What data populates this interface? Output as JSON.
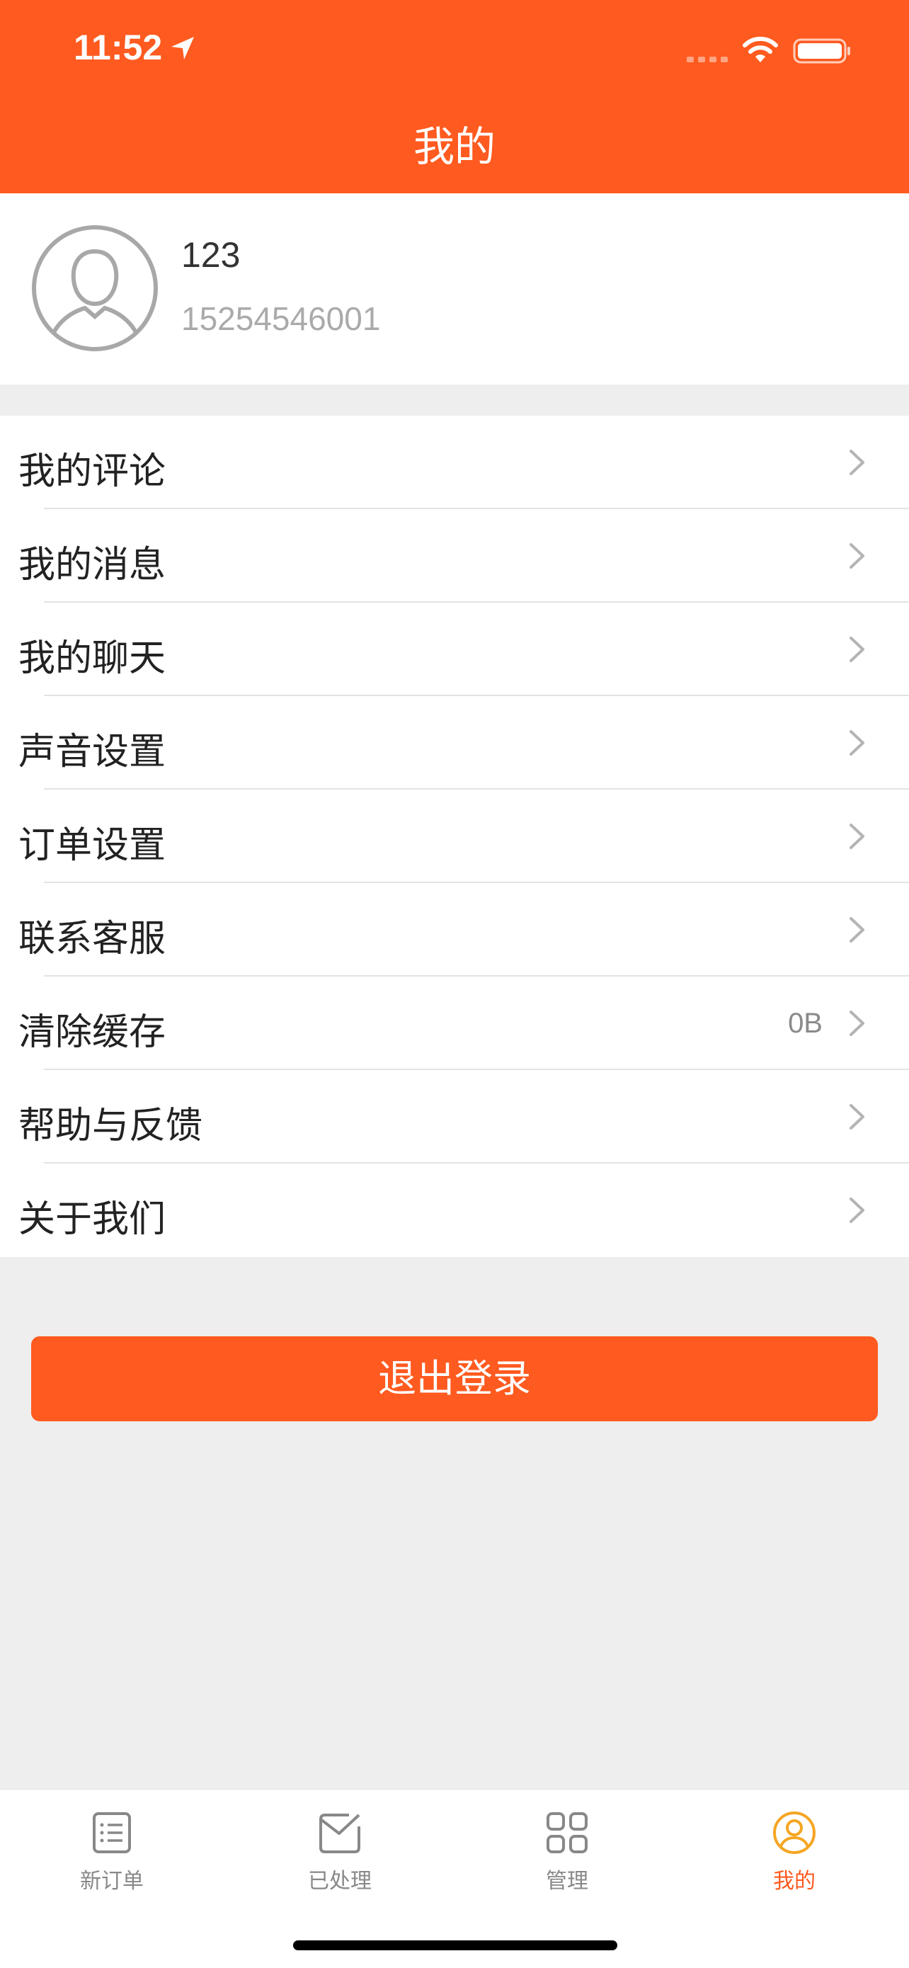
{
  "colors": {
    "accent": "#ff5a1f",
    "background": "#eeeeee",
    "tab_inactive": "#888888"
  },
  "status_bar": {
    "time": "11:52"
  },
  "header": {
    "title": "我的"
  },
  "profile": {
    "name": "123",
    "phone": "15254546001"
  },
  "menu": {
    "items": [
      {
        "label": "我的评论",
        "value": ""
      },
      {
        "label": "我的消息",
        "value": ""
      },
      {
        "label": "我的聊天",
        "value": ""
      },
      {
        "label": "声音设置",
        "value": ""
      },
      {
        "label": "订单设置",
        "value": ""
      },
      {
        "label": "联系客服",
        "value": ""
      },
      {
        "label": "清除缓存",
        "value": "0B"
      },
      {
        "label": "帮助与反馈",
        "value": ""
      },
      {
        "label": "关于我们",
        "value": ""
      }
    ]
  },
  "logout": {
    "label": "退出登录"
  },
  "tabbar": {
    "tabs": [
      {
        "label": "新订单",
        "icon": "list-icon"
      },
      {
        "label": "已处理",
        "icon": "mail-check-icon"
      },
      {
        "label": "管理",
        "icon": "grid-icon"
      },
      {
        "label": "我的",
        "icon": "user-icon",
        "active": true
      }
    ]
  }
}
